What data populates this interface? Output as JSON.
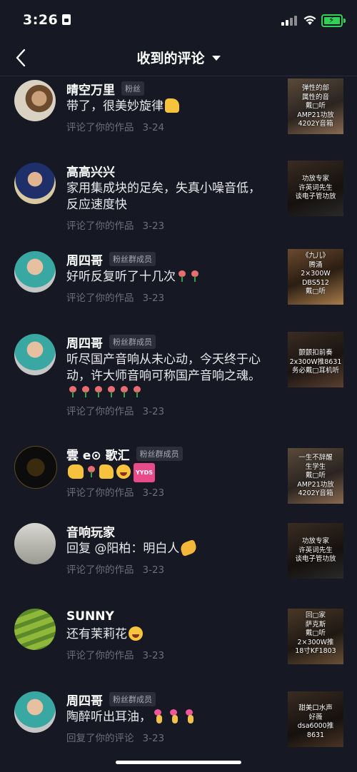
{
  "status_bar": {
    "time": "3:26"
  },
  "nav": {
    "title": "收到的评论"
  },
  "comments": [
    {
      "name": "晴空万里",
      "badge": "粉丝",
      "text": "带了，很美妙旋律",
      "action": "评论了你的作品",
      "date": "3-24",
      "thumb_text": "弹性的部\n属性的音\n戴□听\nAMP21功放\n4202Y音箱"
    },
    {
      "name": "高高兴兴",
      "badge": "",
      "text": "家用集成块的足矣，失真小噪音低，反应速度快",
      "action": "评论了你的作品",
      "date": "3-23",
      "thumb_text": "功放专家\n许英词先生\n谈电子管功放"
    },
    {
      "name": "周四哥",
      "badge": "粉丝群成员",
      "text": "好听反复听了十几次",
      "action": "评论了你的作品",
      "date": "3-23",
      "thumb_text": "《九儿》\n腾涌\n2×300W\nDBS512\n戴□听"
    },
    {
      "name": "周四哥",
      "badge": "粉丝群成员",
      "text": "听尽国产音响从未心动，今天终于心动，许大师音响可称国产音响之魂。",
      "action": "评论了你的作品",
      "date": "3-23",
      "thumb_text": "颤颤扣前奏\n2x300W推8631\n务必戴□耳机听"
    },
    {
      "name": "雲 e⊙ 歌汇",
      "badge": "粉丝群成员",
      "text": "",
      "action": "评论了你的作品",
      "date": "3-23",
      "thumb_text": "一生不辞醒\n生学生\n戴□听\nAMP21功放\n4202Y音箱"
    },
    {
      "name": "音响玩家",
      "badge": "",
      "text": "回复 @阳柏：明白人",
      "action": "评论了你的作品",
      "date": "3-23",
      "thumb_text": "功放专家\n许英词先生\n谈电子管功放"
    },
    {
      "name": "SUNNY",
      "badge": "",
      "text": "还有茉莉花",
      "action": "评论了你的作品",
      "date": "3-23",
      "thumb_text": "回□家\n萨克斯\n戴□听\n2×300W推\n18寸KF1803"
    },
    {
      "name": "周四哥",
      "badge": "粉丝群成员",
      "text": "陶醉听出耳油，",
      "action": "回复了你的评论",
      "date": "3-23",
      "thumb_text": "甜美口水声\n好薇\ndsa6000推8631"
    }
  ],
  "colors": {
    "background": "#161823",
    "battery": "#33d058",
    "meta_text": "#6d6f7b"
  }
}
